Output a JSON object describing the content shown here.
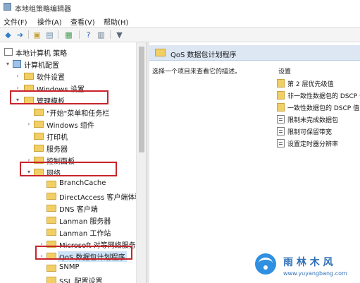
{
  "window": {
    "title": "本地组策略编辑器"
  },
  "menu": [
    "文件(F)",
    "操作(A)",
    "查看(V)",
    "帮助(H)"
  ],
  "toolbar": [
    {
      "icon": "back-arrow-icon",
      "glyph": "◆",
      "color": "#2d7fc9"
    },
    {
      "icon": "forward-arrow-icon",
      "glyph": "➜",
      "color": "#2d7fc9"
    },
    {
      "icon": "up-folder-icon",
      "glyph": "▣",
      "color": "#c9a33a"
    },
    {
      "icon": "show-hide-tree-icon",
      "glyph": "▤",
      "color": "#6a8aa8"
    },
    {
      "icon": "export-list-icon",
      "glyph": "▦",
      "color": "#3a9a4a"
    },
    {
      "icon": "help-icon",
      "glyph": "?",
      "color": "#3060c0"
    },
    {
      "icon": "properties-icon",
      "glyph": "▥",
      "color": "#6a7a8a"
    },
    {
      "icon": "filter-icon",
      "glyph": "▼",
      "color": "#5a6a7a"
    }
  ],
  "tree": [
    {
      "label": "本地计算机 策略",
      "toggle": "",
      "icon": "policy-icon"
    },
    {
      "label": "计算机配置",
      "toggle": "▾",
      "icon": "computer-icon"
    },
    {
      "label": "软件设置",
      "toggle": "›",
      "icon": "folder-icon"
    },
    {
      "label": "Windows 设置",
      "toggle": "›",
      "icon": "folder-icon"
    },
    {
      "label": "管理模板",
      "toggle": "▾",
      "icon": "folder-icon"
    },
    {
      "label": "\"开始\"菜单和任务栏",
      "toggle": "",
      "icon": "folder-icon"
    },
    {
      "label": "Windows 组件",
      "toggle": "›",
      "icon": "folder-icon"
    },
    {
      "label": "打印机",
      "toggle": "",
      "icon": "folder-icon"
    },
    {
      "label": "服务器",
      "toggle": "",
      "icon": "folder-icon"
    },
    {
      "label": "控制面板",
      "toggle": "›",
      "icon": "folder-icon"
    },
    {
      "label": "网络",
      "toggle": "▾",
      "icon": "folder-icon"
    },
    {
      "label": "BranchCache",
      "toggle": "",
      "icon": "folder-icon"
    },
    {
      "label": "DirectAccess 客户端体验设置",
      "toggle": "",
      "icon": "folder-icon"
    },
    {
      "label": "DNS 客户端",
      "toggle": "",
      "icon": "folder-icon"
    },
    {
      "label": "Lanman 服务器",
      "toggle": "",
      "icon": "folder-icon"
    },
    {
      "label": "Lanman 工作站",
      "toggle": "",
      "icon": "folder-icon"
    },
    {
      "label": "Microsoft 对等网络服务",
      "toggle": "›",
      "icon": "folder-icon"
    },
    {
      "label": "QoS 数据包计划程序",
      "toggle": "›",
      "icon": "folder-icon"
    },
    {
      "label": "SNMP",
      "toggle": "",
      "icon": "folder-icon"
    },
    {
      "label": "SSL 配置设置",
      "toggle": "",
      "icon": "folder-icon"
    }
  ],
  "selected_item": "QoS 数据包计划程序",
  "details": {
    "header": "QoS 数据包计划程序",
    "description": "选择一个项目来查看它的描述。",
    "column_header": "设置"
  },
  "settings": [
    {
      "label": "第 2 层优先级值",
      "icon": "folder-icon"
    },
    {
      "label": "非一致性数据包的 DSCP 值",
      "icon": "folder-icon"
    },
    {
      "label": "一致性数据包的 DSCP 值",
      "icon": "folder-icon"
    },
    {
      "label": "限制未完成数据包",
      "icon": "policy-setting-icon"
    },
    {
      "label": "限制可保留带宽",
      "icon": "policy-setting-icon"
    },
    {
      "label": "设置定时器分辨率",
      "icon": "policy-setting-icon"
    }
  ],
  "watermark": {
    "text": "雨 林 木 风",
    "url": "www.yuyangbang.com"
  },
  "colors": {
    "highlight_box": "#c8242b",
    "folder": "#f2cf64",
    "header_bg": "#dce7f3",
    "selection": "#cfe3f7"
  }
}
